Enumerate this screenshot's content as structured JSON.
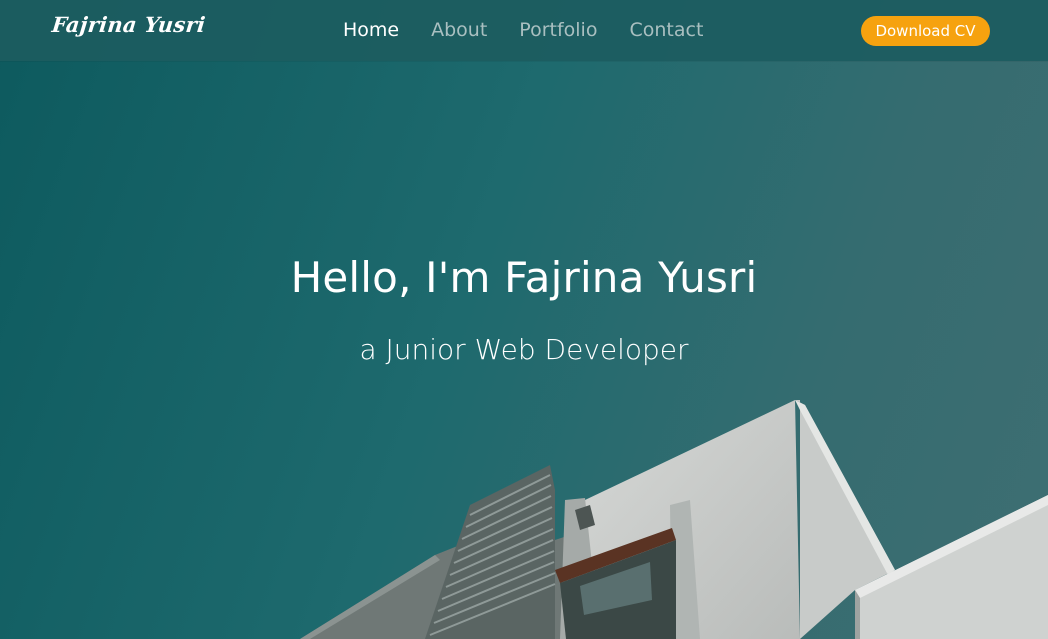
{
  "navbar": {
    "brand": "Fajrina Yusri",
    "links": [
      {
        "label": "Home",
        "active": true
      },
      {
        "label": "About",
        "active": false
      },
      {
        "label": "Portfolio",
        "active": false
      },
      {
        "label": "Contact",
        "active": false
      }
    ],
    "cv_button": "Download CV"
  },
  "hero": {
    "title": "Hello, I'm Fajrina Yusri",
    "subtitle": "a Junior Web Developer",
    "background_image": "building-against-teal-sky"
  },
  "colors": {
    "nav_bg": "#1c5c60",
    "hero_bg": "#1e6a6e",
    "accent": "#f6a20f",
    "nav_inactive": "#a9bfc0",
    "text": "#ffffff"
  }
}
